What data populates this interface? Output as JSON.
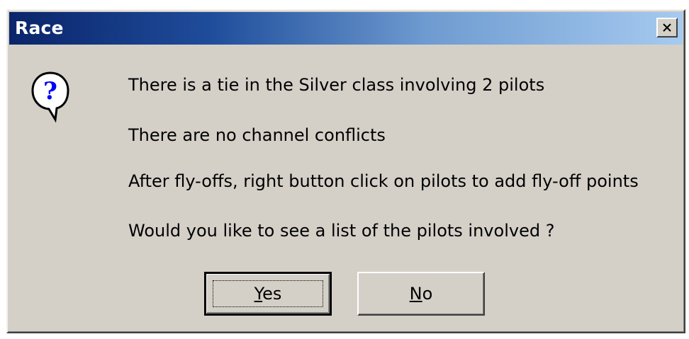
{
  "window": {
    "title": "Race"
  },
  "icons": {
    "close": "close-icon",
    "question": "question-icon"
  },
  "message": {
    "line1": "There is a tie in the Silver class involving 2 pilots",
    "line2": "There are no channel conflicts",
    "line3": "After fly-offs, right button click on pilots to add fly-off points",
    "line4": "Would you like to see a list of the pilots involved ?"
  },
  "buttons": {
    "yes": {
      "mnemonic": "Y",
      "rest": "es"
    },
    "no": {
      "mnemonic": "N",
      "rest": "o"
    }
  },
  "colors": {
    "dialog_background": "#d4d0c8",
    "titlebar_start": "#0a246a",
    "titlebar_end": "#a6caf0",
    "question_mark": "#0000ff"
  }
}
